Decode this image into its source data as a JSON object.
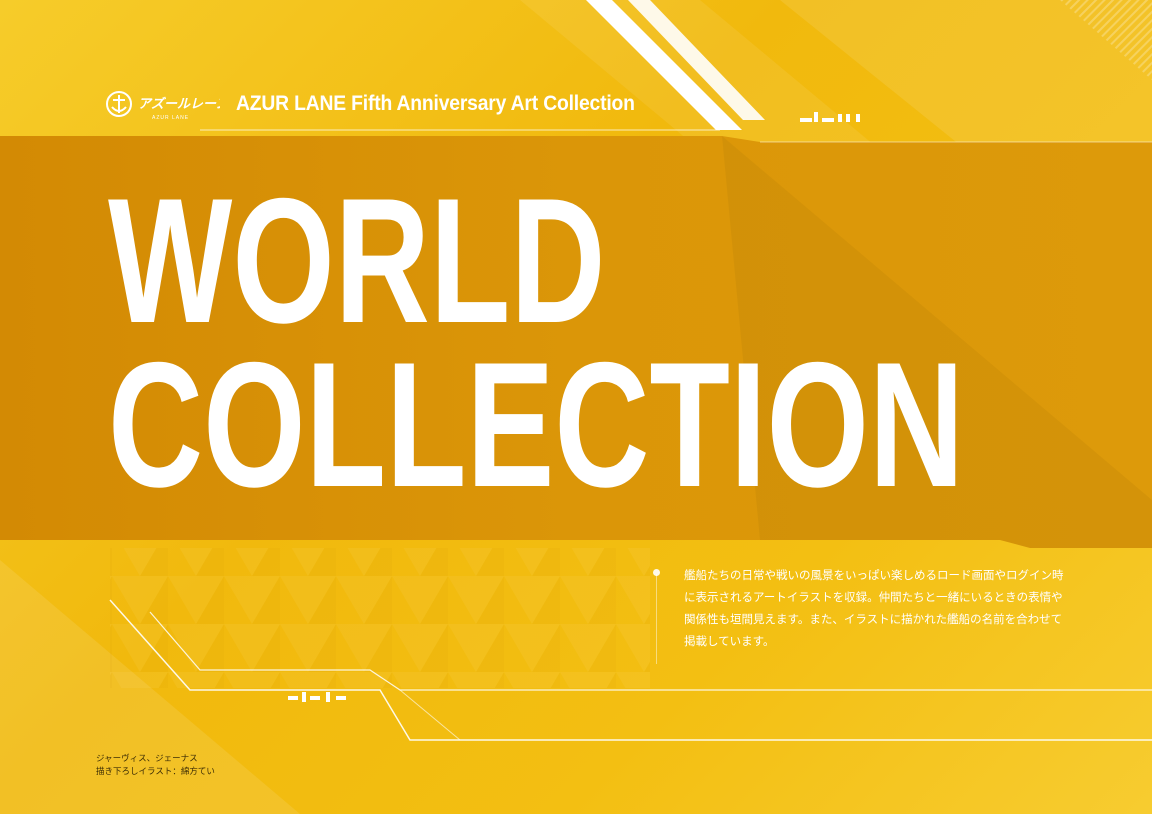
{
  "logo": {
    "jp_text": "アズールレーン",
    "en_text": "AZUR LANE"
  },
  "header": {
    "title": "AZUR LANE  Fifth Anniversary Art Collection"
  },
  "headline": {
    "line1": "WORLD",
    "line2": "COLLECTION"
  },
  "description": "艦船たちの日常や戦いの風景をいっぱい楽しめるロード画面やログイン時に表示されるアートイラストを収録。仲間たちと一緒にいるときの表情や関係性も垣間見えます。また、イラストに描かれた艦船の名前を合わせて掲載しています。",
  "credit": {
    "characters": "ジャーヴィス、ジェーナス",
    "illustrator": "描き下ろしイラスト：綿方てい"
  },
  "colors": {
    "background": "#f2bd0f",
    "band": "#d99206",
    "text": "#ffffff"
  }
}
